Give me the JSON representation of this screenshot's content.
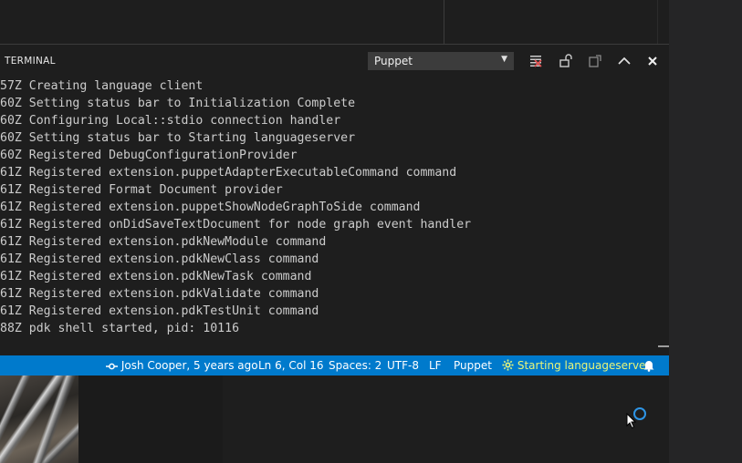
{
  "panel": {
    "title": "TERMINAL",
    "terminal_select": "Puppet"
  },
  "terminal_lines": [
    "57Z Creating language client",
    "60Z Setting status bar to Initialization Complete",
    "60Z Configuring Local::stdio connection handler",
    "60Z Setting status bar to Starting languageserver",
    "60Z Registered DebugConfigurationProvider",
    "61Z Registered extension.puppetAdapterExecutableCommand command",
    "61Z Registered Format Document provider",
    "61Z Registered extension.puppetShowNodeGraphToSide command",
    "61Z Registered onDidSaveTextDocument for node graph event handler",
    "61Z Registered extension.pdkNewModule command",
    "61Z Registered extension.pdkNewClass command",
    "61Z Registered extension.pdkNewTask command",
    "61Z Registered extension.pdkValidate command",
    "61Z Registered extension.pdkTestUnit command",
    "88Z pdk shell started, pid: 10116"
  ],
  "status_bar": {
    "git_blame": "Josh Cooper, 5 years ago",
    "cursor_position": "Ln 6, Col 16",
    "indentation": "Spaces: 2",
    "encoding": "UTF-8",
    "line_ending": "LF",
    "language": "Puppet",
    "server_status": "Starting languageserver",
    "server_status_color": "#ffffff",
    "accent_color": "#007acc"
  },
  "icons": {
    "terminal_header": [
      "clear-icon",
      "lock-icon",
      "new-terminal-icon",
      "maximize-icon",
      "close-icon"
    ],
    "status": [
      "git-commit-icon",
      "gear-icon",
      "bell-icon"
    ]
  }
}
